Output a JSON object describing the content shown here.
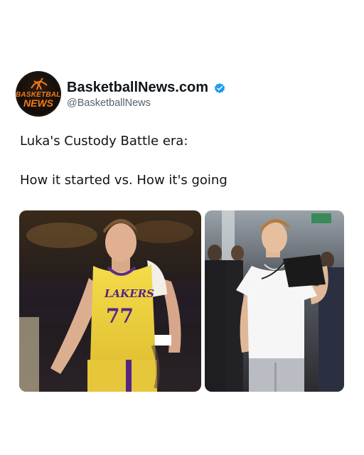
{
  "account": {
    "display_name": "BasketballNews.com",
    "handle": "@BasketballNews",
    "avatar_line1": "BASKETBALL",
    "avatar_line2": "NEWS",
    "verified_color": "#1d9bf0"
  },
  "post": {
    "line1": "Luka's Custody Battle era:",
    "line2": "How it started vs. How it's going"
  },
  "images": [
    {
      "jersey_team": "LAKERS",
      "jersey_number": "77"
    },
    {}
  ]
}
